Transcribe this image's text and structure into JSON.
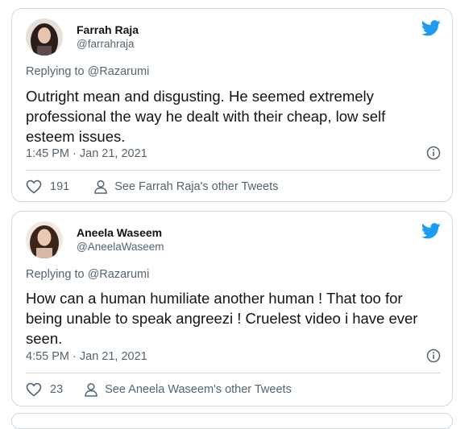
{
  "tweets": [
    {
      "name": "Farrah Raja",
      "handle": "@farrahraja",
      "replying": "Replying to @Razarumi",
      "body": "Outright mean and disgusting. He seemed extremely\nprofessional the way he dealt with their cheap, low self\nesteem issues.",
      "time": "1:45 PM · Jan 21, 2021",
      "likes": "191",
      "other": "See Farrah Raja's other Tweets"
    },
    {
      "name": "Aneela Waseem",
      "handle": "@AneelaWaseem",
      "replying": "Replying to @Razarumi",
      "body": "How can a human humiliate another human ! That too for\nbeing unable to speak angreezi !  Cruelest video i have ever\nseen.",
      "time": "4:55 PM · Jan 21, 2021",
      "likes": "23",
      "other": "See Aneela Waseem's other Tweets"
    }
  ],
  "icons": {
    "brand": "twitter-bird-icon",
    "info": "info-icon",
    "like": "heart-icon",
    "profile": "person-icon"
  },
  "colors": {
    "twitter_blue": "#1d9bf0",
    "secondary_text": "#536471",
    "border": "#cfd9de"
  }
}
